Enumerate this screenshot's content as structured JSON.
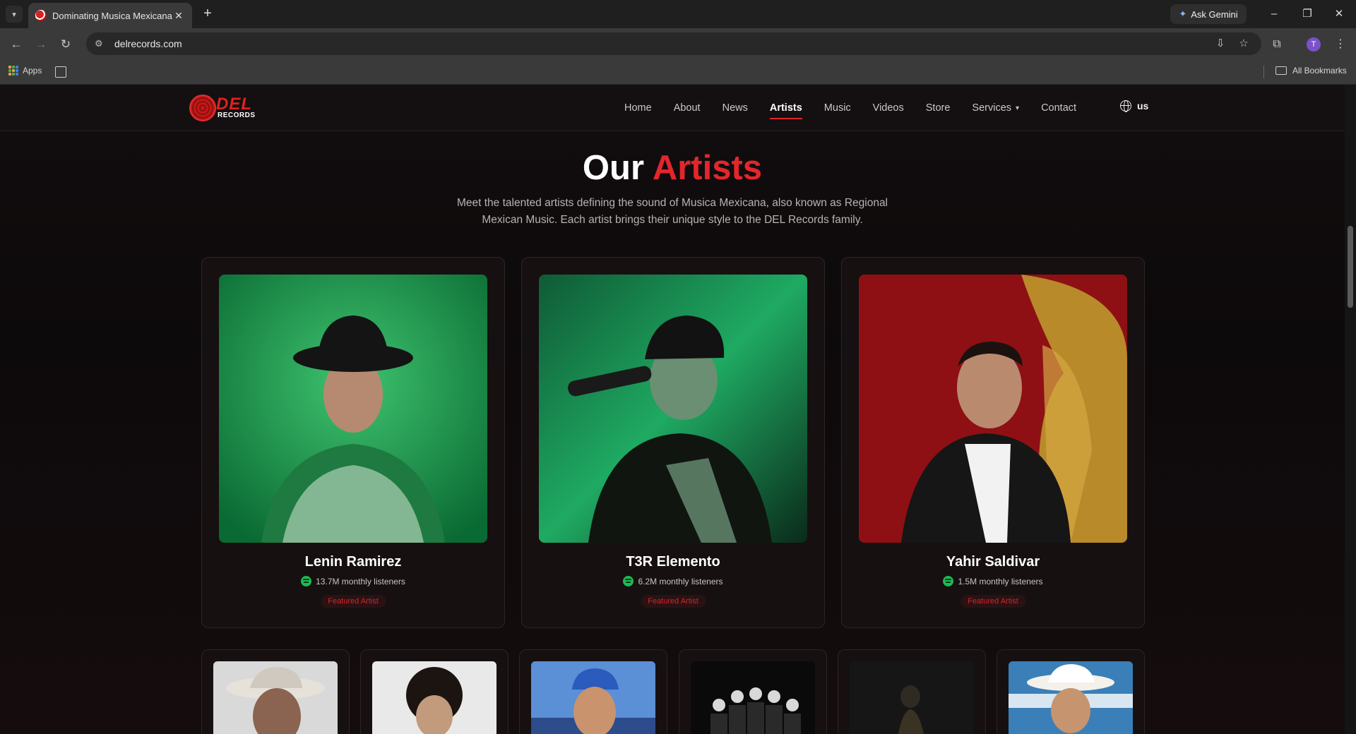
{
  "browser": {
    "tab_title": "Dominating Musica Mexicana |",
    "url": "delrecords.com",
    "ask_gemini": "Ask Gemini",
    "profile_initial": "T",
    "bookmarks_apps": "Apps",
    "all_bookmarks": "All Bookmarks"
  },
  "site": {
    "logo_text": "DEL",
    "logo_subtext": "RECORDS",
    "nav": [
      "Home",
      "About",
      "News",
      "Artists",
      "Music",
      "Videos",
      "Store",
      "Services",
      "Contact"
    ],
    "active_nav": "Artists",
    "language": "us"
  },
  "hero": {
    "title_prefix": "Our",
    "title_accent": "Artists",
    "subtitle": "Meet the talented artists defining the sound of Musica Mexicana, also known as Regional Mexican Music. Each artist brings their unique style to the DEL Records family."
  },
  "featured_artists": [
    {
      "name": "Lenin Ramirez",
      "listeners": "13.7M monthly listeners",
      "badge": "Featured Artist"
    },
    {
      "name": "T3R Elemento",
      "listeners": "6.2M monthly listeners",
      "badge": "Featured Artist"
    },
    {
      "name": "Yahir Saldivar",
      "listeners": "1.5M monthly listeners",
      "badge": "Featured Artist"
    }
  ],
  "colors": {
    "accent": "#e3262b",
    "spotify": "#1db954",
    "background": "#0d0a0a"
  }
}
